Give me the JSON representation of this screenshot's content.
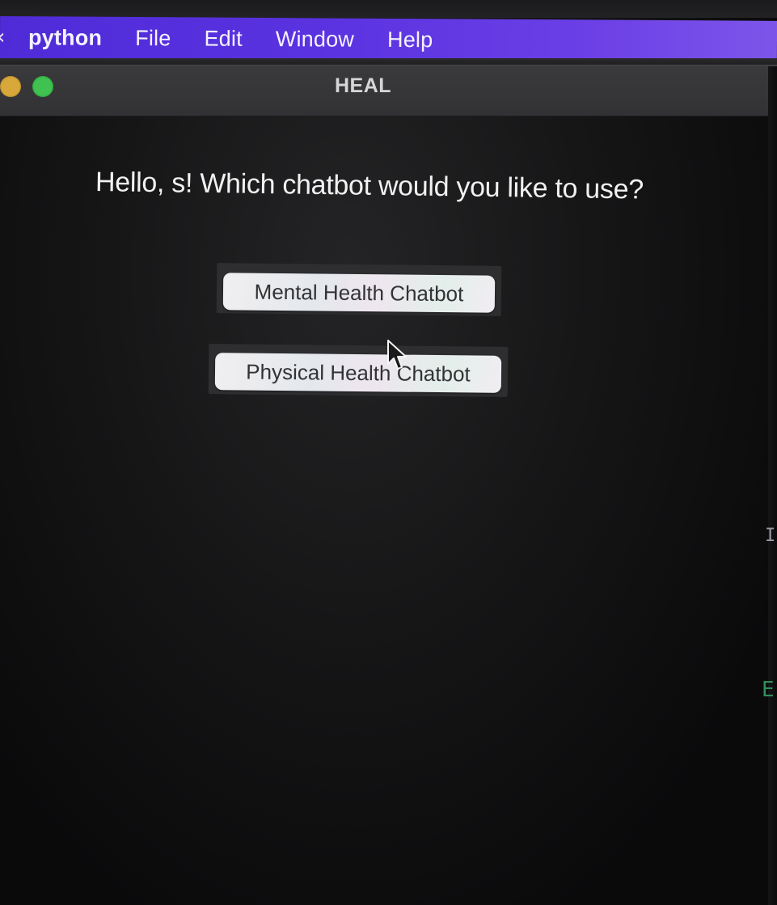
{
  "menubar": {
    "app_name": "python",
    "items": [
      "File",
      "Edit",
      "Window",
      "Help"
    ]
  },
  "window": {
    "title": "HEAL"
  },
  "main": {
    "prompt": "Hello, s! Which chatbot would you like to use?",
    "buttons": {
      "mental": "Mental Health Chatbot",
      "physical": "Physical Health Chatbot"
    }
  },
  "edge_glyphs": {
    "right_top": "I",
    "right_bottom": "E"
  },
  "colors": {
    "menubar": "#5a32e0",
    "traffic_yellow": "#d9a83a",
    "traffic_green": "#3fc24f",
    "background": "#161617"
  }
}
